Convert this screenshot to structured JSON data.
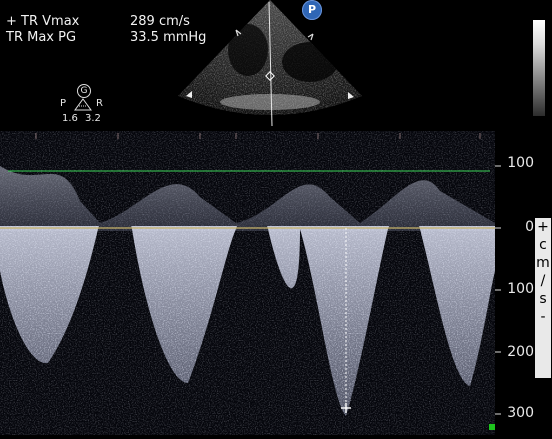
{
  "measurements": [
    {
      "label": "+ TR Vmax",
      "value": "289 cm/s"
    },
    {
      "label": "TR Max PG",
      "value": "33.5 mmHg"
    }
  ],
  "orientation": {
    "symbol": "G",
    "left": "P",
    "right": "R",
    "value_left": "1.6",
    "value_right": "3.2"
  },
  "probe_badge": "P",
  "velocity_scale": {
    "unit_chars": [
      "+",
      "c",
      "m",
      "/",
      "s",
      "-"
    ],
    "ticks": [
      {
        "label": "100",
        "value": 100
      },
      {
        "label": "0",
        "value": 0
      },
      {
        "label": "100",
        "value": -100
      },
      {
        "label": "200",
        "value": -200
      },
      {
        "label": "300",
        "value": -300
      }
    ]
  },
  "baseline_color": "#c7b36a",
  "reference_line_color": "#3dd65a",
  "marker_color": "#1ec41e"
}
